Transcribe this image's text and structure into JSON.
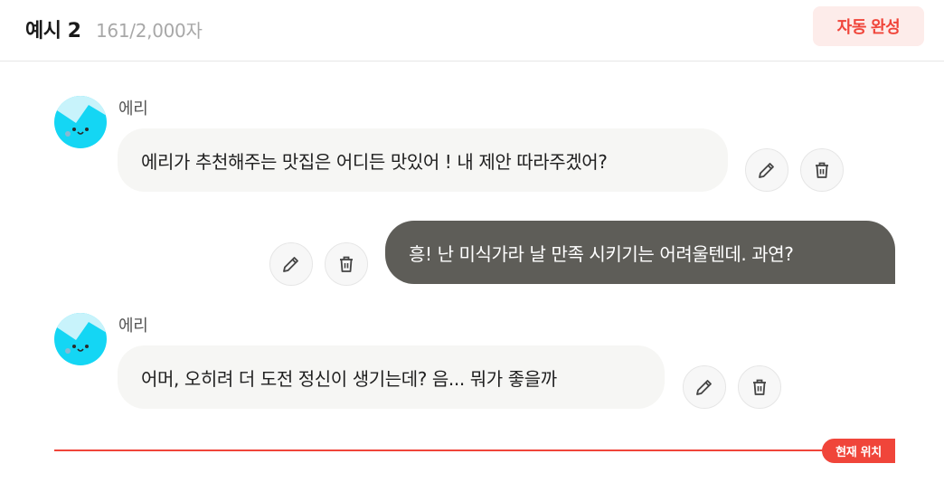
{
  "header": {
    "title": "예시 2",
    "char_count": "161/2,000자",
    "auto_complete_label": "자동 완성"
  },
  "messages": [
    {
      "role": "bot",
      "sender": "에리",
      "text": "에리가 추천해주는 맛집은 어디든 맛있어 ! 내 제안 따라주겠어?"
    },
    {
      "role": "user",
      "text": "흥! 난 미식가라 날 만족 시키기는 어려울텐데. 과연?"
    },
    {
      "role": "bot",
      "sender": "에리",
      "text": "어머, 오히려 더 도전 정신이 생기는데? 음... 뭐가 좋을까"
    }
  ],
  "current_position_label": "현재 위치",
  "icons": {
    "edit": "pencil-icon",
    "delete": "trash-icon"
  },
  "colors": {
    "accent": "#f0453a",
    "accent_bg": "#fdecea",
    "user_bubble": "#5e5d58",
    "bot_bubble": "#f6f6f4",
    "avatar": "#14d6f4"
  }
}
